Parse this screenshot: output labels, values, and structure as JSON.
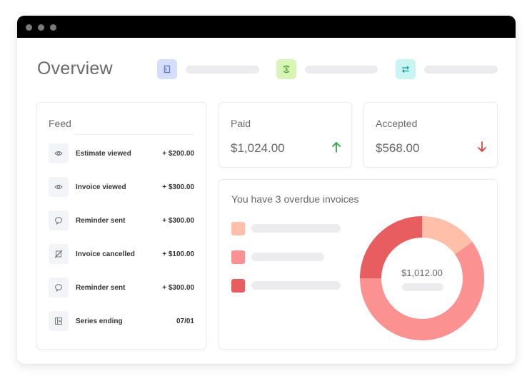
{
  "window": {
    "title_dots": [
      "window-dot",
      "window-dot",
      "window-dot"
    ]
  },
  "header": {
    "title": "Overview",
    "quick_items": [
      {
        "icon": "document-icon",
        "bg": "#d4defa",
        "fg": "#5b74d8"
      },
      {
        "icon": "dollar-cycle-icon",
        "bg": "#d8f5b8",
        "fg": "#4f9a28"
      },
      {
        "icon": "transfer-arrows-icon",
        "bg": "#c8f4f1",
        "fg": "#1f9b93"
      }
    ]
  },
  "feed": {
    "title": "Feed",
    "items": [
      {
        "icon": "eye-icon",
        "label": "Estimate viewed",
        "amount": "+ $200.00"
      },
      {
        "icon": "eye-icon",
        "label": "Invoice viewed",
        "amount": "+ $300.00"
      },
      {
        "icon": "chat-bubble-icon",
        "label": "Reminder sent",
        "amount": "+ $300.00"
      },
      {
        "icon": "cancelled-icon",
        "label": "Invoice cancelled",
        "amount": "+ $100.00"
      },
      {
        "icon": "chat-bubble-icon",
        "label": "Reminder sent",
        "amount": "+ $300.00"
      },
      {
        "icon": "calendar-icon",
        "label": "Series ending",
        "amount": "07/01"
      }
    ]
  },
  "stats": {
    "paid": {
      "label": "Paid",
      "value": "$1,024.00",
      "trend": "up",
      "trend_color": "#2faa3c"
    },
    "accepted": {
      "label": "Accepted",
      "value": "$568.00",
      "trend": "down",
      "trend_color": "#d9453f"
    }
  },
  "overdue": {
    "title": "You have 3 overdue invoices",
    "total": "$1,012.00",
    "slices": [
      {
        "color": "#ffbfa8",
        "fraction": 0.15
      },
      {
        "color": "#fb9191",
        "fraction": 0.6
      },
      {
        "color": "#e85d5f",
        "fraction": 0.25
      }
    ]
  }
}
